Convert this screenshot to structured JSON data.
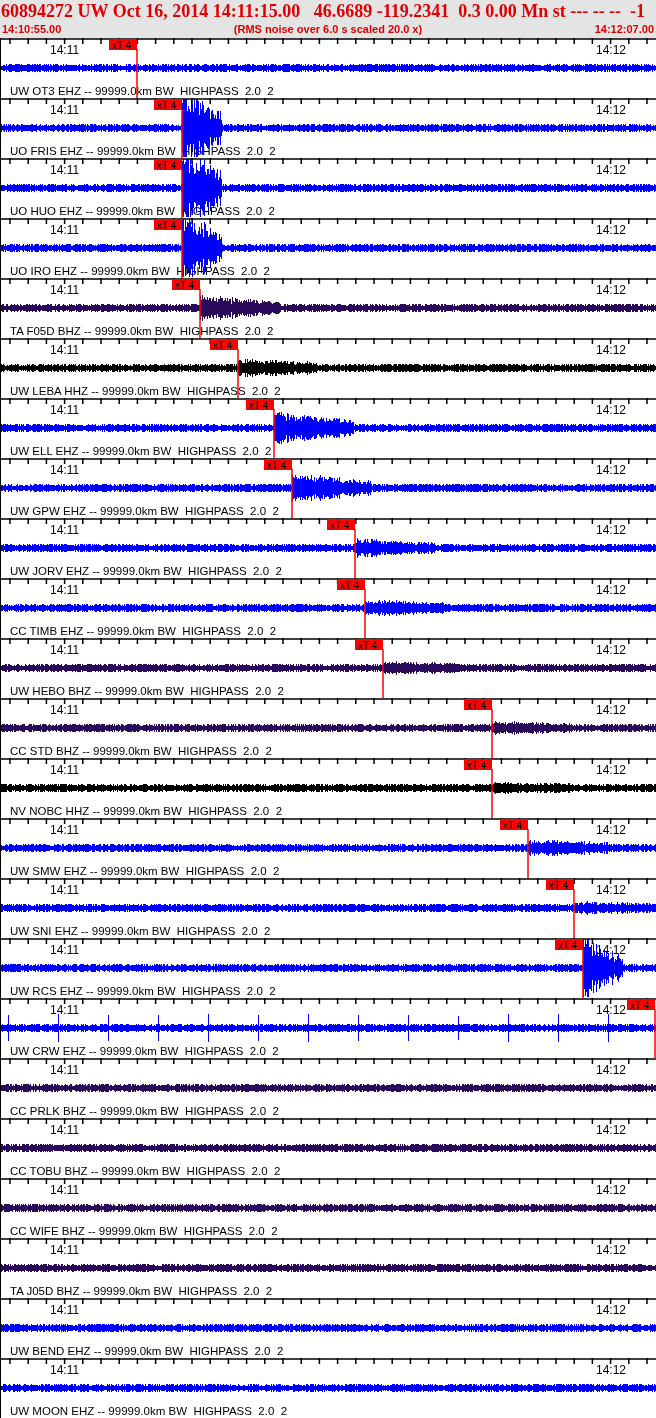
{
  "header": {
    "title": "60894272 UW Oct 16, 2014 14:11:15.00   46.6689 -119.2341  0.3 0.00 Mn st --- -- --  -1",
    "start_time": "14:10:55.00",
    "note": "(RMS noise over 6.0 s scaled 20.0 x)",
    "end_time": "14:12:07.00"
  },
  "traces": [
    {
      "label": "UW OT3 EHZ -- 99999.0km BW  HIGHPASS  2.0  2",
      "color": "#0000ff",
      "time_marks": [
        "14:11",
        "14:12"
      ],
      "pick": "xT 4"
    },
    {
      "label": "UO FRIS EHZ -- 99999.0km BW  HIGHPASS  2.0  2",
      "color": "#0000ff",
      "time_marks": [
        "14:11",
        "14:12"
      ],
      "pick": "xT 4"
    },
    {
      "label": "UO HUO EHZ -- 99999.0km BW  HIGHPASS  2.0  2",
      "color": "#0000ff",
      "time_marks": [
        "14:11",
        "14:12"
      ],
      "pick": "xT 4"
    },
    {
      "label": "UO IRO EHZ -- 99999.0km BW  HIGHPASS  2.0  2",
      "color": "#0000ff",
      "time_marks": [
        "14:11",
        "14:12"
      ],
      "pick": "xT 4"
    },
    {
      "label": "TA F05D BHZ -- 99999.0km BW  HIGHPASS  2.0  2",
      "color": "#2a0a5a",
      "time_marks": [
        "14:11",
        "14:12"
      ],
      "pick": "xT 4"
    },
    {
      "label": "UW LEBA HHZ -- 99999.0km BW  HIGHPASS  2.0  2",
      "color": "#000000",
      "time_marks": [
        "14:11",
        "14:12"
      ],
      "pick": "xT 4"
    },
    {
      "label": "UW ELL EHZ -- 99999.0km BW  HIGHPASS  2.0  2",
      "color": "#0000ff",
      "time_marks": [
        "14:11",
        "14:12"
      ],
      "pick": "xT 4"
    },
    {
      "label": "UW GPW EHZ -- 99999.0km BW  HIGHPASS  2.0  2",
      "color": "#0000ff",
      "time_marks": [
        "14:11",
        "14:12"
      ],
      "pick": "xT 4"
    },
    {
      "label": "UW JORV EHZ -- 99999.0km BW  HIGHPASS  2.0  2",
      "color": "#0000ff",
      "time_marks": [
        "14:11",
        "14:12"
      ],
      "pick": "xT 4"
    },
    {
      "label": "CC TIMB EHZ -- 99999.0km BW  HIGHPASS  2.0  2",
      "color": "#0000ff",
      "time_marks": [
        "14:11",
        "14:12"
      ],
      "pick": "xT 4"
    },
    {
      "label": "UW HEBO BHZ -- 99999.0km BW  HIGHPASS  2.0  2",
      "color": "#2a0a5a",
      "time_marks": [
        "14:11",
        "14:12"
      ],
      "pick": "xT 4"
    },
    {
      "label": "CC STD BHZ -- 99999.0km BW  HIGHPASS  2.0  2",
      "color": "#2a0a5a",
      "time_marks": [
        "14:11",
        "14:12"
      ],
      "pick": "xT 4"
    },
    {
      "label": "NV NOBC HHZ -- 99999.0km BW  HIGHPASS  2.0  2",
      "color": "#000000",
      "time_marks": [
        "14:11",
        "14:12"
      ],
      "pick": "xT 4"
    },
    {
      "label": "UW SMW EHZ -- 99999.0km BW  HIGHPASS  2.0  2",
      "color": "#0000ff",
      "time_marks": [
        "14:11",
        "14:12"
      ],
      "pick": "xT 4"
    },
    {
      "label": "UW SNI EHZ -- 99999.0km BW  HIGHPASS  2.0  2",
      "color": "#0000ff",
      "time_marks": [
        "14:11",
        "14:12"
      ],
      "pick": "xT 4"
    },
    {
      "label": "UW RCS EHZ -- 99999.0km BW  HIGHPASS  2.0  2",
      "color": "#0000ff",
      "time_marks": [
        "14:11",
        "14:12"
      ],
      "pick": "xT 4"
    },
    {
      "label": "UW CRW EHZ -- 99999.0km BW  HIGHPASS  2.0  2",
      "color": "#0000ff",
      "time_marks": [
        "14:11",
        "14:12"
      ],
      "pick": "xT 4"
    },
    {
      "label": "CC PRLK BHZ -- 99999.0km BW  HIGHPASS  2.0  2",
      "color": "#2a0a5a",
      "time_marks": [
        "14:11",
        "14:12"
      ]
    },
    {
      "label": "CC TOBU BHZ -- 99999.0km BW  HIGHPASS  2.0  2",
      "color": "#2a0a5a",
      "time_marks": [
        "14:11",
        "14:12"
      ]
    },
    {
      "label": "CC WIFE BHZ -- 99999.0km BW  HIGHPASS  2.0  2",
      "color": "#2a0a5a",
      "time_marks": [
        "14:11",
        "14:12"
      ]
    },
    {
      "label": "TA J05D BHZ -- 99999.0km BW  HIGHPASS  2.0  2",
      "color": "#2a0a5a",
      "time_marks": [
        "14:11",
        "14:12"
      ]
    },
    {
      "label": "UW BEND EHZ -- 99999.0km BW  HIGHPASS  2.0  2",
      "color": "#0000ff",
      "time_marks": [
        "14:11",
        "14:12"
      ]
    },
    {
      "label": "UW MOON EHZ -- 99999.0km BW  HIGHPASS  2.0  2",
      "color": "#0000ff",
      "time_marks": [
        "14:11",
        "14:12"
      ]
    }
  ]
}
